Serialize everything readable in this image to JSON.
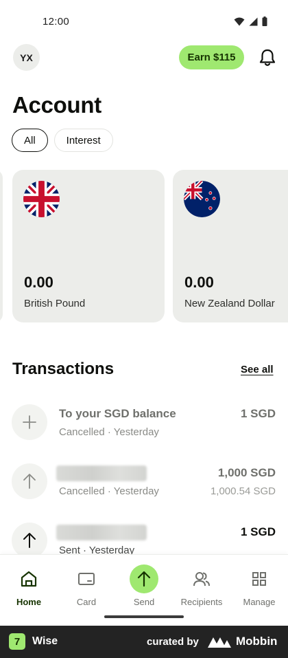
{
  "status_bar": {
    "time": "12:00"
  },
  "header": {
    "avatar_initials": "YX",
    "earn_label": "Earn $115"
  },
  "page": {
    "title": "Account"
  },
  "filters": {
    "items": [
      {
        "label": "All",
        "active": true
      },
      {
        "label": "Interest",
        "active": false
      }
    ]
  },
  "balances": [
    {
      "amount": "0.00",
      "currency_name": "British Pound",
      "flag": "uk-flag-icon"
    },
    {
      "amount": "0.00",
      "currency_name": "New Zealand Dollar",
      "flag": "nz-flag-icon"
    }
  ],
  "transactions_section": {
    "title": "Transactions",
    "see_all_label": "See all"
  },
  "transactions": [
    {
      "icon": "plus-icon",
      "title": "To your SGD balance",
      "subtitle": "Cancelled · Yesterday",
      "amount": "1 SGD",
      "amount_secondary": ""
    },
    {
      "icon": "arrow-up-icon",
      "title": "",
      "subtitle": "Cancelled · Yesterday",
      "amount": "1,000 SGD",
      "amount_secondary": "1,000.54 SGD"
    },
    {
      "icon": "arrow-up-icon",
      "title": "",
      "subtitle": "Sent · Yesterday",
      "amount": "1 SGD",
      "amount_secondary": ""
    }
  ],
  "bottom_nav": {
    "items": [
      {
        "label": "Home",
        "icon": "home-icon",
        "active": true
      },
      {
        "label": "Card",
        "icon": "card-icon",
        "active": false
      },
      {
        "label": "Send",
        "icon": "send-icon",
        "active": false
      },
      {
        "label": "Recipients",
        "icon": "recipients-icon",
        "active": false
      },
      {
        "label": "Manage",
        "icon": "grid-icon",
        "active": false
      }
    ]
  },
  "footer": {
    "app_name": "Wise",
    "curated_by": "curated by",
    "brand": "Mobbin"
  },
  "colors": {
    "accent": "#9fe870",
    "accent_text": "#163300",
    "card_bg": "#ecedea"
  }
}
